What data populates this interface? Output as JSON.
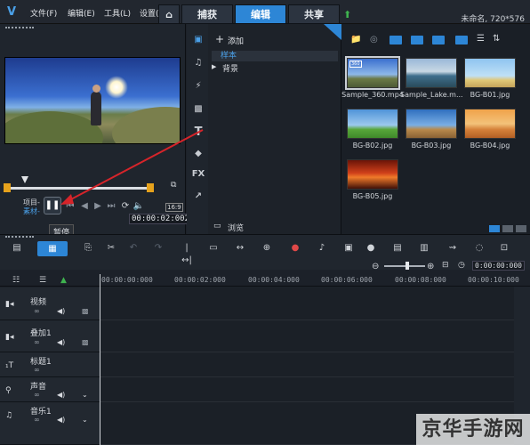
{
  "menu": {
    "file": "文件(F)",
    "edit": "编辑(E)",
    "tools": "工具(L)",
    "settings": "设置("
  },
  "tabs": {
    "home": "⌂",
    "capture": "捕获",
    "edit": "编辑",
    "share": "共享"
  },
  "project": {
    "name": "未命名, 720*576"
  },
  "player": {
    "mode_project": "项目-",
    "mode_clip": "素材-",
    "pause_tooltip": "暂停",
    "timecode": "00:00:02:002",
    "ratio": "16:9"
  },
  "library": {
    "add_label": "添加",
    "folders": [
      "样本",
      "背景"
    ],
    "browse_label": "浏览",
    "side_icons": {
      "text": "T",
      "fx": "FX"
    },
    "thumbs": [
      {
        "label": "Sample_360.mp4",
        "badge": "360"
      },
      {
        "label": "Sample_Lake.m..."
      },
      {
        "label": "BG-B01.jpg"
      },
      {
        "label": "BG-B02.jpg"
      },
      {
        "label": "BG-B03.jpg"
      },
      {
        "label": "BG-B04.jpg"
      },
      {
        "label": "BG-B05.jpg"
      }
    ]
  },
  "timeline": {
    "timecode": "0:00:00:000",
    "ruler": [
      "00:00:00:000",
      "00:00:02:000",
      "00:00:04:000",
      "00:00:06:000",
      "00:00:08:000",
      "00:00:10:000"
    ],
    "tracks": [
      {
        "name": "视频",
        "icon": "video-track-icon"
      },
      {
        "name": "叠加1",
        "icon": "overlay-track-icon"
      },
      {
        "name": "标题1",
        "icon": "title-track-icon"
      },
      {
        "name": "声音",
        "icon": "voice-track-icon"
      },
      {
        "name": "音乐1",
        "icon": "music-track-icon"
      }
    ]
  },
  "watermark": "京华手游网",
  "colors": {
    "accent": "#2d86d6",
    "marker": "#e6a21c",
    "arrow": "#d6242a"
  }
}
